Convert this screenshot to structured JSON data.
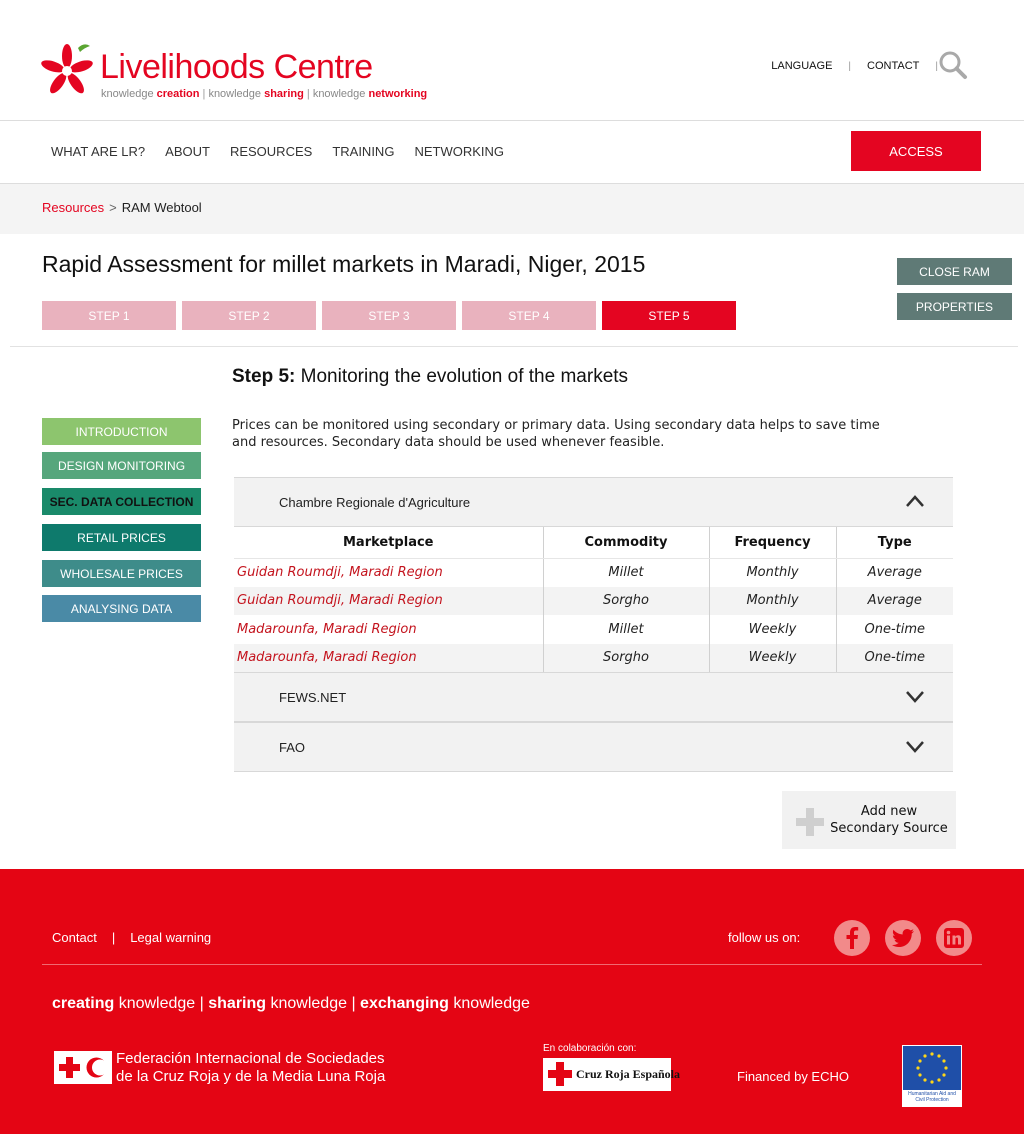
{
  "brand": {
    "name_part1": "Live",
    "name_part2": "lihoods Centre",
    "tagline_word1": "knowledge ",
    "tagline_bold1": "creation",
    "tagline_sep1": " | ",
    "tagline_word2": "knowledge ",
    "tagline_bold2": "sharing",
    "tagline_sep2": " | ",
    "tagline_word3": "knowledge ",
    "tagline_bold3": "networking",
    "accent_color": "#e40521"
  },
  "top_links": {
    "language": "LANGUAGE",
    "contact": "CONTACT",
    "divider": "|"
  },
  "nav": {
    "items": [
      "WHAT ARE LR?",
      "ABOUT",
      "RESOURCES",
      "TRAINING",
      "NETWORKING"
    ],
    "access": "ACCESS"
  },
  "breadcrumb": {
    "root": "Resources",
    "sep": ">",
    "current": "RAM Webtool"
  },
  "page": {
    "title": "Rapid Assessment for millet markets in Maradi, Niger, 2015",
    "steps": [
      "STEP 1",
      "STEP 2",
      "STEP 3",
      "STEP 4",
      "STEP 5"
    ],
    "active_step": 5,
    "close_ram": "CLOSE RAM",
    "properties": "PROPERTIES"
  },
  "left_menu": {
    "items": [
      {
        "label": "INTRODUCTION",
        "color": "#8dc56e"
      },
      {
        "label": "DESIGN MONITORING",
        "color": "#56a67c"
      },
      {
        "label": "SEC. DATA COLLECTION",
        "color": "#1a8a6a"
      },
      {
        "label": "RETAIL PRICES",
        "color": "#0e7a6c"
      },
      {
        "label": "WHOLESALE PRICES",
        "color": "#3e8c8a"
      },
      {
        "label": "ANALYSING DATA",
        "color": "#4a8aa6"
      }
    ]
  },
  "main": {
    "heading_bold": "Step 5:",
    "heading_rest": " Monitoring the evolution of the markets",
    "intro": "Prices can be monitored using secondary or primary data. Using secondary data helps to save time and resources. Secondary data should be used whenever feasible.",
    "sources": [
      {
        "title": "Chambre Regionale d'Agriculture",
        "expanded": true
      },
      {
        "title": "FEWS.NET",
        "expanded": false
      },
      {
        "title": "FAO",
        "expanded": false
      }
    ],
    "table": {
      "headers": [
        "Marketplace",
        "Commodity",
        "Frequency",
        "Type"
      ],
      "rows": [
        [
          "Guidan Roumdji, Maradi Region",
          "Millet",
          "Monthly",
          "Average"
        ],
        [
          "Guidan Roumdji, Maradi Region",
          "Sorgho",
          "Monthly",
          "Average"
        ],
        [
          "Madarounfa, Maradi Region",
          "Millet",
          "Weekly",
          "One-time"
        ],
        [
          "Madarounfa, Maradi Region",
          "Sorgho",
          "Weekly",
          "One-time"
        ]
      ]
    },
    "add_source_line1": "Add new",
    "add_source_line2": "Secondary Source"
  },
  "footer": {
    "contact": "Contact",
    "sep": "|",
    "legal": "Legal warning",
    "follow": "follow us on:",
    "tagline_b1": "creating",
    "tagline_t1": " knowledge | ",
    "tagline_b2": "sharing",
    "tagline_t2": " knowledge | ",
    "tagline_b3": "exchanging",
    "tagline_t3": " knowledge",
    "ifrc_line1": "Federación Internacional de Sociedades",
    "ifrc_line2": "de la Cruz Roja y de la Media Luna Roja",
    "colab": "En colaboración con:",
    "cruz_roja": "Cruz Roja Española",
    "financed": "Financed by ECHO",
    "eu_caption": "Humanitarian Aid and Civil Protection",
    "bg_color": "#e40514"
  }
}
